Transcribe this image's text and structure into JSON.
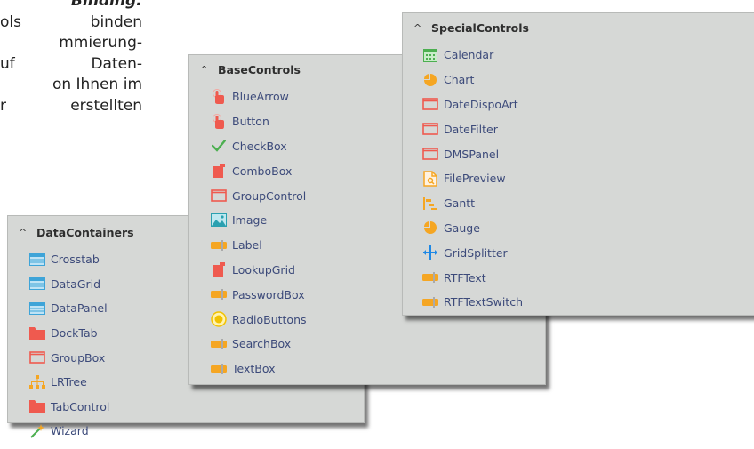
{
  "background_text": {
    "line1": "Binding:",
    "line2_a": "ols",
    "line2_b": "binden",
    "line3": "mmierung-",
    "line4_a": "uf",
    "line4_b": "Daten-",
    "line5": "on Ihnen im",
    "line6_a": "r",
    "line6_b": "erstellten"
  },
  "data_containers": {
    "title": "DataContainers",
    "items": [
      {
        "label": "Crosstab",
        "icon": "table-icon"
      },
      {
        "label": "DataGrid",
        "icon": "table-icon"
      },
      {
        "label": "DataPanel",
        "icon": "table-icon"
      },
      {
        "label": "DockTab",
        "icon": "folder-icon"
      },
      {
        "label": "GroupBox",
        "icon": "frame-icon"
      },
      {
        "label": "LRTree",
        "icon": "tree-icon"
      },
      {
        "label": "TabControl",
        "icon": "folder-icon"
      },
      {
        "label": "Wizard",
        "icon": "magic-wand-icon"
      }
    ]
  },
  "base_controls": {
    "title": "BaseControls",
    "items": [
      {
        "label": "BlueArrow",
        "icon": "hand-pointer-icon"
      },
      {
        "label": "Button",
        "icon": "hand-pointer-icon"
      },
      {
        "label": "CheckBox",
        "icon": "checkmark-icon"
      },
      {
        "label": "ComboBox",
        "icon": "combobox-icon"
      },
      {
        "label": "GroupControl",
        "icon": "frame-icon"
      },
      {
        "label": "Image",
        "icon": "image-icon"
      },
      {
        "label": "Label",
        "icon": "textfield-icon"
      },
      {
        "label": "LookupGrid",
        "icon": "combobox-icon"
      },
      {
        "label": "PasswordBox",
        "icon": "textfield-icon"
      },
      {
        "label": "RadioButtons",
        "icon": "radio-icon"
      },
      {
        "label": "SearchBox",
        "icon": "textfield-icon"
      },
      {
        "label": "TextBox",
        "icon": "textfield-icon"
      }
    ]
  },
  "special_controls": {
    "title": "SpecialControls",
    "items": [
      {
        "label": "Calendar",
        "icon": "calendar-icon"
      },
      {
        "label": "Chart",
        "icon": "pie-chart-icon"
      },
      {
        "label": "DateDispoArt",
        "icon": "frame-icon"
      },
      {
        "label": "DateFilter",
        "icon": "frame-icon"
      },
      {
        "label": "DMSPanel",
        "icon": "frame-icon"
      },
      {
        "label": "FilePreview",
        "icon": "file-preview-icon"
      },
      {
        "label": "Gantt",
        "icon": "gantt-icon"
      },
      {
        "label": "Gauge",
        "icon": "pie-chart-icon"
      },
      {
        "label": "GridSplitter",
        "icon": "splitter-icon"
      },
      {
        "label": "RTFText",
        "icon": "textfield-icon"
      },
      {
        "label": "RTFTextSwitch",
        "icon": "textfield-icon"
      }
    ]
  },
  "colors": {
    "panel_bg": "#d6d8d6",
    "item_text": "#3c4a7a",
    "icon_blue": "#3ea4d8",
    "icon_red": "#ef5a4f",
    "icon_orange": "#f5a623",
    "icon_green": "#4caf50"
  }
}
